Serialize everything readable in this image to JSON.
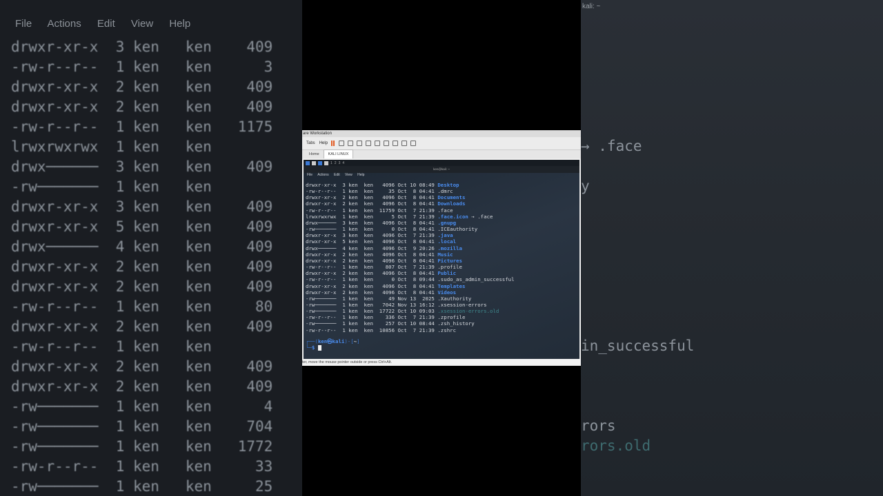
{
  "bg_left": {
    "menu": [
      "File",
      "Actions",
      "Edit",
      "View",
      "Help"
    ],
    "rows": [
      "drwxr-xr-x  3 ken   ken    409",
      "-rw-r--r--  1 ken   ken      3",
      "drwxr-xr-x  2 ken   ken    409",
      "drwxr-xr-x  2 ken   ken    409",
      "-rw-r--r--  1 ken   ken   1175",
      "lrwxrwxrwx  1 ken   ken      ",
      "drwx──────  3 ken   ken    409",
      "-rw───────  1 ken   ken      ",
      "drwxr-xr-x  3 ken   ken    409",
      "drwxr-xr-x  5 ken   ken    409",
      "drwx──────  4 ken   ken    409",
      "drwxr-xr-x  2 ken   ken    409",
      "drwxr-xr-x  2 ken   ken    409",
      "-rw-r--r--  1 ken   ken     80",
      "drwxr-xr-x  2 ken   ken    409",
      "-rw-r--r--  1 ken   ken      ",
      "drwxr-xr-x  2 ken   ken    409",
      "drwxr-xr-x  2 ken   ken    409",
      "-rw───────  1 ken   ken      4",
      "-rw───────  1 ken   ken    704",
      "-rw───────  1 ken   ken   1772",
      "-rw-r--r--  1 ken   ken     33",
      "-rw───────  1 ken   ken     25"
    ]
  },
  "bg_right": {
    "title": "kali: ~",
    "face": "→ .face",
    "y": "y",
    "successful": "in_successful",
    "errors": "rors",
    "errors_old": "rors.old"
  },
  "vm": {
    "title": "are Workstation",
    "toolbar": {
      "tabs": "Tabs",
      "help": "Help"
    },
    "tabs": {
      "home": "Home",
      "kali": "KALI LINUX"
    },
    "status": "ter, move the mouse pointer outside or press Ctrl+Alt."
  },
  "guest": {
    "workspaces": [
      "1",
      "2",
      "3",
      "4"
    ],
    "term_title": "ken@kali: ~",
    "term_menu": [
      "File",
      "Actions",
      "Edit",
      "View",
      "Help"
    ],
    "listing": [
      {
        "perm": "drwxr-xr-x",
        "n": "3",
        "u": "ken",
        "g": "ken",
        "size": "4096",
        "mon": "Oct",
        "day": "10",
        "time": "08:49",
        "name": "Desktop",
        "kind": "dir"
      },
      {
        "perm": "-rw-r--r--",
        "n": "1",
        "u": "ken",
        "g": "ken",
        "size": "35",
        "mon": "Oct",
        "day": "8",
        "time": "04:41",
        "name": ".dmrc",
        "kind": "file"
      },
      {
        "perm": "drwxr-xr-x",
        "n": "2",
        "u": "ken",
        "g": "ken",
        "size": "4096",
        "mon": "Oct",
        "day": "8",
        "time": "04:41",
        "name": "Documents",
        "kind": "dir"
      },
      {
        "perm": "drwxr-xr-x",
        "n": "2",
        "u": "ken",
        "g": "ken",
        "size": "4096",
        "mon": "Oct",
        "day": "8",
        "time": "04:41",
        "name": "Downloads",
        "kind": "dir"
      },
      {
        "perm": "-rw-r--r--",
        "n": "1",
        "u": "ken",
        "g": "ken",
        "size": "11759",
        "mon": "Oct",
        "day": "7",
        "time": "21:39",
        "name": ".face",
        "kind": "file"
      },
      {
        "perm": "lrwxrwxrwx",
        "n": "1",
        "u": "ken",
        "g": "ken",
        "size": "5",
        "mon": "Oct",
        "day": "7",
        "time": "21:39",
        "name": ".face.icon",
        "kind": "link",
        "target": "→ .face"
      },
      {
        "perm": "drwx──────",
        "n": "3",
        "u": "ken",
        "g": "ken",
        "size": "4096",
        "mon": "Oct",
        "day": "8",
        "time": "04:41",
        "name": ".gnupg",
        "kind": "dir"
      },
      {
        "perm": "-rw───────",
        "n": "1",
        "u": "ken",
        "g": "ken",
        "size": "0",
        "mon": "Oct",
        "day": "8",
        "time": "04:41",
        "name": ".ICEauthority",
        "kind": "file"
      },
      {
        "perm": "drwxr-xr-x",
        "n": "3",
        "u": "ken",
        "g": "ken",
        "size": "4096",
        "mon": "Oct",
        "day": "7",
        "time": "21:39",
        "name": ".java",
        "kind": "dir"
      },
      {
        "perm": "drwxr-xr-x",
        "n": "5",
        "u": "ken",
        "g": "ken",
        "size": "4096",
        "mon": "Oct",
        "day": "8",
        "time": "04:41",
        "name": ".local",
        "kind": "dir"
      },
      {
        "perm": "drwx──────",
        "n": "4",
        "u": "ken",
        "g": "ken",
        "size": "4096",
        "mon": "Oct",
        "day": "9",
        "time": "20:26",
        "name": ".mozilla",
        "kind": "dir"
      },
      {
        "perm": "drwxr-xr-x",
        "n": "2",
        "u": "ken",
        "g": "ken",
        "size": "4096",
        "mon": "Oct",
        "day": "8",
        "time": "04:41",
        "name": "Music",
        "kind": "dir"
      },
      {
        "perm": "drwxr-xr-x",
        "n": "2",
        "u": "ken",
        "g": "ken",
        "size": "4096",
        "mon": "Oct",
        "day": "8",
        "time": "04:41",
        "name": "Pictures",
        "kind": "dir"
      },
      {
        "perm": "-rw-r--r--",
        "n": "1",
        "u": "ken",
        "g": "ken",
        "size": "807",
        "mon": "Oct",
        "day": "7",
        "time": "21:39",
        "name": ".profile",
        "kind": "file"
      },
      {
        "perm": "drwxr-xr-x",
        "n": "2",
        "u": "ken",
        "g": "ken",
        "size": "4096",
        "mon": "Oct",
        "day": "8",
        "time": "04:41",
        "name": "Public",
        "kind": "dir"
      },
      {
        "perm": "-rw-r--r--",
        "n": "1",
        "u": "ken",
        "g": "ken",
        "size": "0",
        "mon": "Oct",
        "day": "8",
        "time": "09:44",
        "name": ".sudo_as_admin_successful",
        "kind": "file"
      },
      {
        "perm": "drwxr-xr-x",
        "n": "2",
        "u": "ken",
        "g": "ken",
        "size": "4096",
        "mon": "Oct",
        "day": "8",
        "time": "04:41",
        "name": "Templates",
        "kind": "dir"
      },
      {
        "perm": "drwxr-xr-x",
        "n": "2",
        "u": "ken",
        "g": "ken",
        "size": "4096",
        "mon": "Oct",
        "day": "8",
        "time": "04:41",
        "name": "Videos",
        "kind": "dir"
      },
      {
        "perm": "-rw───────",
        "n": "1",
        "u": "ken",
        "g": "ken",
        "size": "49",
        "mon": "Nov",
        "day": "13",
        "time": "2025",
        "name": ".Xauthority",
        "kind": "file"
      },
      {
        "perm": "-rw───────",
        "n": "1",
        "u": "ken",
        "g": "ken",
        "size": "7042",
        "mon": "Nov",
        "day": "13",
        "time": "16:12",
        "name": ".xsession-errors",
        "kind": "file"
      },
      {
        "perm": "-rw───────",
        "n": "1",
        "u": "ken",
        "g": "ken",
        "size": "17722",
        "mon": "Oct",
        "day": "10",
        "time": "09:03",
        "name": ".xsession-errors.old",
        "kind": "dimfile"
      },
      {
        "perm": "-rw-r--r--",
        "n": "1",
        "u": "ken",
        "g": "ken",
        "size": "336",
        "mon": "Oct",
        "day": "7",
        "time": "21:39",
        "name": ".zprofile",
        "kind": "file"
      },
      {
        "perm": "-rw───────",
        "n": "1",
        "u": "ken",
        "g": "ken",
        "size": "257",
        "mon": "Oct",
        "day": "10",
        "time": "08:44",
        "name": ".zsh_history",
        "kind": "file"
      },
      {
        "perm": "-rw-r--r--",
        "n": "1",
        "u": "ken",
        "g": "ken",
        "size": "10856",
        "mon": "Oct",
        "day": "7",
        "time": "21:39",
        "name": ".zshrc",
        "kind": "file"
      }
    ],
    "prompt": {
      "user": "ken㉿kali",
      "cwd": "~",
      "line2": "$"
    }
  },
  "colors": {
    "dir": "#4a8df0",
    "dimfile": "#3f8a8f",
    "text": "#d6d9de"
  }
}
